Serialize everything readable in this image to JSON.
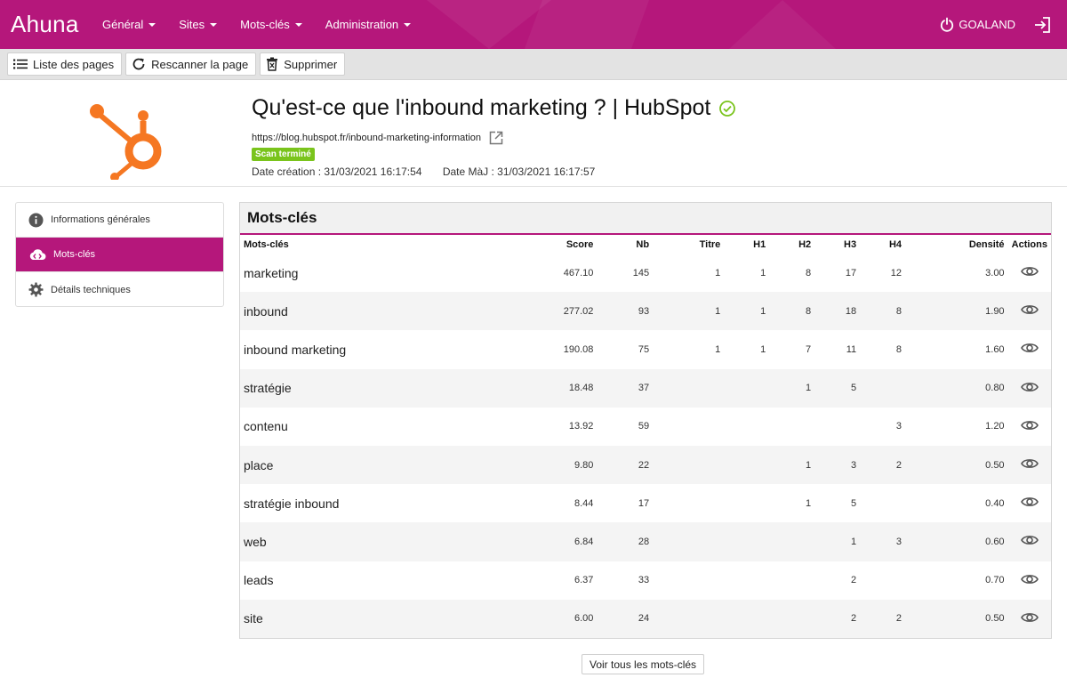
{
  "brand": "Ahuna",
  "nav": {
    "items": [
      {
        "label": "Général"
      },
      {
        "label": "Sites"
      },
      {
        "label": "Mots-clés"
      },
      {
        "label": "Administration"
      }
    ],
    "org": "GOALAND"
  },
  "toolbar": {
    "list_label": "Liste des pages",
    "rescan_label": "Rescanner la page",
    "delete_label": "Supprimer"
  },
  "page": {
    "title": "Qu'est-ce que l'inbound marketing ? | HubSpot",
    "url": "https://blog.hubspot.fr/inbound-marketing-information",
    "status": "Scan terminé",
    "created": "Date création : 31/03/2021 16:17:54",
    "updated": "Date MàJ : 31/03/2021 16:17:57"
  },
  "sidebar": {
    "items": [
      {
        "label": "Informations générales"
      },
      {
        "label": "Mots-clés"
      },
      {
        "label": "Détails techniques"
      }
    ]
  },
  "panel": {
    "title": "Mots-clés",
    "columns": [
      "Mots-clés",
      "Score",
      "Nb",
      "Titre",
      "H1",
      "H2",
      "H3",
      "H4",
      "Densité",
      "Actions"
    ],
    "rows": [
      [
        "marketing",
        "467.10",
        "145",
        "1",
        "1",
        "8",
        "17",
        "12",
        "3.00"
      ],
      [
        "inbound",
        "277.02",
        "93",
        "1",
        "1",
        "8",
        "18",
        "8",
        "1.90"
      ],
      [
        "inbound marketing",
        "190.08",
        "75",
        "1",
        "1",
        "7",
        "11",
        "8",
        "1.60"
      ],
      [
        "stratégie",
        "18.48",
        "37",
        "",
        "",
        "1",
        "5",
        "",
        "0.80"
      ],
      [
        "contenu",
        "13.92",
        "59",
        "",
        "",
        "",
        "",
        "3",
        "1.20"
      ],
      [
        "place",
        "9.80",
        "22",
        "",
        "",
        "1",
        "3",
        "2",
        "0.50"
      ],
      [
        "stratégie inbound",
        "8.44",
        "17",
        "",
        "",
        "1",
        "5",
        "",
        "0.40"
      ],
      [
        "web",
        "6.84",
        "28",
        "",
        "",
        "",
        "1",
        "3",
        "0.60"
      ],
      [
        "leads",
        "6.37",
        "33",
        "",
        "",
        "",
        "2",
        "",
        "0.70"
      ],
      [
        "site",
        "6.00",
        "24",
        "",
        "",
        "",
        "2",
        "2",
        "0.50"
      ]
    ],
    "see_all_label": "Voir tous les mots-clés"
  },
  "colors": {
    "accent": "#b5177b",
    "success": "#7ac41c",
    "hubspot": "#f57722"
  }
}
